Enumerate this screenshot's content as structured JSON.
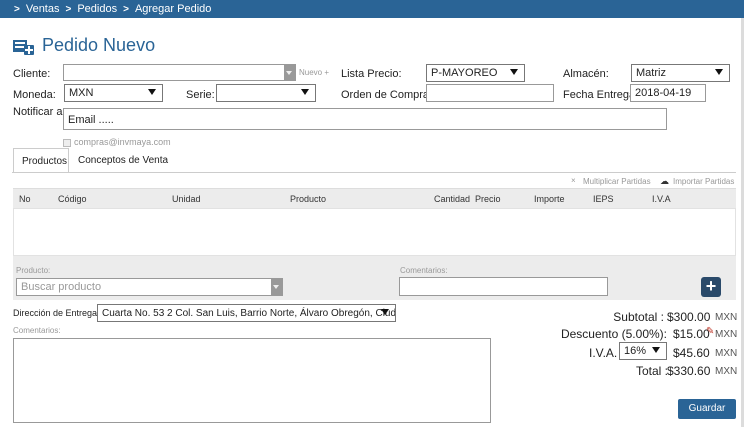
{
  "breadcrumb": [
    "Ventas",
    "Pedidos",
    "Agregar Pedido"
  ],
  "page_title": "Pedido Nuevo",
  "form": {
    "cliente_label": "Cliente:",
    "cliente_value": "",
    "nuevo_link": "Nuevo +",
    "lista_precio_label": "Lista Precio:",
    "lista_precio_value": "P-MAYOREO",
    "almacen_label": "Almacén:",
    "almacen_value": "Matriz",
    "moneda_label": "Moneda:",
    "moneda_value": "MXN",
    "serie_label": "Serie:",
    "serie_value": "",
    "orden_compra_label": "Orden de Compra:",
    "orden_compra_value": "",
    "fecha_entrega_label": "Fecha Entrega:",
    "fecha_entrega_value": "2018-04-19",
    "notificar_label": "Notificar a:",
    "email_placeholder": "Email .....",
    "email_suggestion": "compras@invmaya.com"
  },
  "tabs": [
    "Productos",
    "Conceptos de Venta"
  ],
  "actions": {
    "multiplicar": "Multiplicar Partidas",
    "importar": "Importar Partidas"
  },
  "grid_columns": [
    "No",
    "Código",
    "Unidad",
    "Producto",
    "Cantidad",
    "Precio",
    "Importe",
    "IEPS",
    "I.V.A"
  ],
  "add_row": {
    "producto_label": "Producto:",
    "producto_placeholder": "Buscar producto",
    "comentarios_label": "Comentarios:"
  },
  "direccion_label": "Dirección de Entrega:",
  "direccion_value": "Cuarta No. 53 2 Col. San Luis, Barrio Norte, Álvaro Obregón, Ciud",
  "comentarios_label": "Comentarios:",
  "totals": {
    "subtotal_label": "Subtotal :",
    "subtotal_value": "$300.00",
    "descuento_label": "Descuento (5.00%):",
    "descuento_value": "$15.00",
    "iva_label": "I.V.A. :",
    "iva_rate": "16%",
    "iva_value": "$45.60",
    "total_label": "Total :",
    "total_value": "$330.60",
    "currency": "MXN"
  },
  "save_button": "Guardar",
  "colors": {
    "accent": "#2a6496",
    "grid": "#ececec"
  }
}
